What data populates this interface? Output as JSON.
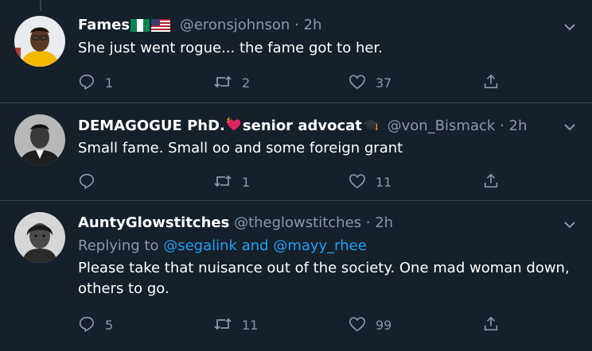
{
  "tweets": [
    {
      "name": "Fames",
      "handle": "@eronsjohnson",
      "separator": "·",
      "time": "2h",
      "text": "She just went rogue... the fame got to her.",
      "replies": "1",
      "retweets": "2",
      "likes": "37"
    },
    {
      "name": "DEMAGOGUE PhD.",
      "name_suffix": "senior advocat",
      "handle": "@von_Bismack",
      "separator": "·",
      "time": "2h",
      "text": "Small fame. Small oo and some foreign grant",
      "replies": "",
      "retweets": "1",
      "likes": "11"
    },
    {
      "name": "AuntyGlowstitches",
      "handle": "@theglowstitches",
      "separator": "·",
      "time": "2h",
      "replying_prefix": "Replying to",
      "mention_1": "@segalink",
      "replying_and": "and",
      "mention_2": "@mayy_rhee",
      "text": "Please take that nuisance out of the society. One mad woman down, others to go.",
      "replies": "5",
      "retweets": "11",
      "likes": "99"
    }
  ],
  "icons": {
    "reply": "reply-icon",
    "retweet": "retweet-icon",
    "like": "heart-icon",
    "share": "share-icon",
    "more": "chevron-down-icon"
  },
  "colors": {
    "background": "#15202b",
    "muted": "#8899a6",
    "link": "#1da1f2",
    "divider": "#38444d"
  }
}
